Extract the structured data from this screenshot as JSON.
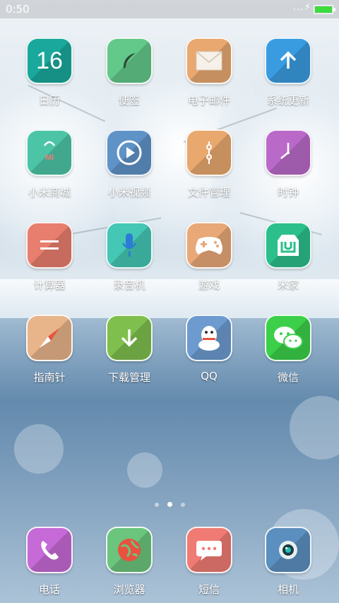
{
  "status_bar": {
    "time": "0:50",
    "signal_dots": "...",
    "battery_level": 1.0,
    "battery_color": "#3ddc3d"
  },
  "apps": [
    {
      "label": "日历",
      "icon": "calendar-icon",
      "color": "#1aa89c",
      "glyph": "16"
    },
    {
      "label": "便签",
      "icon": "notes-icon",
      "color": "#63c98a",
      "glyph": ""
    },
    {
      "label": "电子邮件",
      "icon": "mail-icon",
      "color": "#e8a870",
      "glyph": ""
    },
    {
      "label": "系统更新",
      "icon": "update-icon",
      "color": "#3a9ce0",
      "glyph": ""
    },
    {
      "label": "小米商城",
      "icon": "mi-store-icon",
      "color": "#4cc5a7",
      "glyph": "MI"
    },
    {
      "label": "小米视频",
      "icon": "video-icon",
      "color": "#5f93c8",
      "glyph": ""
    },
    {
      "label": "文件管理",
      "icon": "file-manager-icon",
      "color": "#e8a86e",
      "glyph": ""
    },
    {
      "label": "时钟",
      "icon": "clock-icon",
      "color": "#b96ac9",
      "glyph": ""
    },
    {
      "label": "计算器",
      "icon": "calculator-icon",
      "color": "#e87e6d",
      "glyph": "="
    },
    {
      "label": "录音机",
      "icon": "recorder-icon",
      "color": "#44c7b4",
      "glyph": ""
    },
    {
      "label": "游戏",
      "icon": "gamepad-icon",
      "color": "#e8a878",
      "glyph": ""
    },
    {
      "label": "米家",
      "icon": "mijia-icon",
      "color": "#2bbf8c",
      "glyph": ""
    },
    {
      "label": "指南针",
      "icon": "compass-icon",
      "color": "#e8b48a",
      "glyph": ""
    },
    {
      "label": "下载管理",
      "icon": "download-icon",
      "color": "#7fbf4e",
      "glyph": ""
    },
    {
      "label": "QQ",
      "icon": "qq-penguin-icon",
      "color": "#6d9bd0",
      "glyph": ""
    },
    {
      "label": "微信",
      "icon": "wechat-icon",
      "color": "#3cd04a",
      "glyph": ""
    }
  ],
  "pager": {
    "pages": 3,
    "active": 1
  },
  "dock": [
    {
      "label": "电话",
      "icon": "phone-icon",
      "color": "#c56ad6"
    },
    {
      "label": "浏览器",
      "icon": "browser-icon",
      "color": "#6bc57d"
    },
    {
      "label": "短信",
      "icon": "messages-icon",
      "color": "#f07b74"
    },
    {
      "label": "相机",
      "icon": "camera-icon",
      "color": "#5b8fc0"
    }
  ]
}
